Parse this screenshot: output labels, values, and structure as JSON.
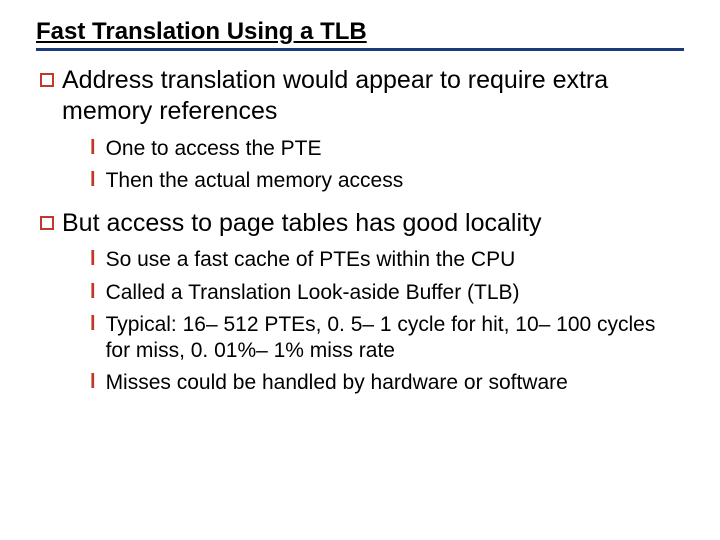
{
  "title": "Fast Translation Using a TLB",
  "bullets": [
    {
      "text": "Address translation would appear to require extra memory references",
      "sub": [
        "One to access the PTE",
        "Then the actual memory access"
      ]
    },
    {
      "text": "But access to page tables has good locality",
      "sub": [
        "So use a fast cache of PTEs within the CPU",
        "Called a Translation Look-aside Buffer (TLB)",
        "Typical: 16– 512 PTEs, 0. 5– 1 cycle for hit, 10– 100 cycles for miss, 0. 01%– 1% miss rate",
        "Misses could be handled by hardware or software"
      ]
    }
  ]
}
